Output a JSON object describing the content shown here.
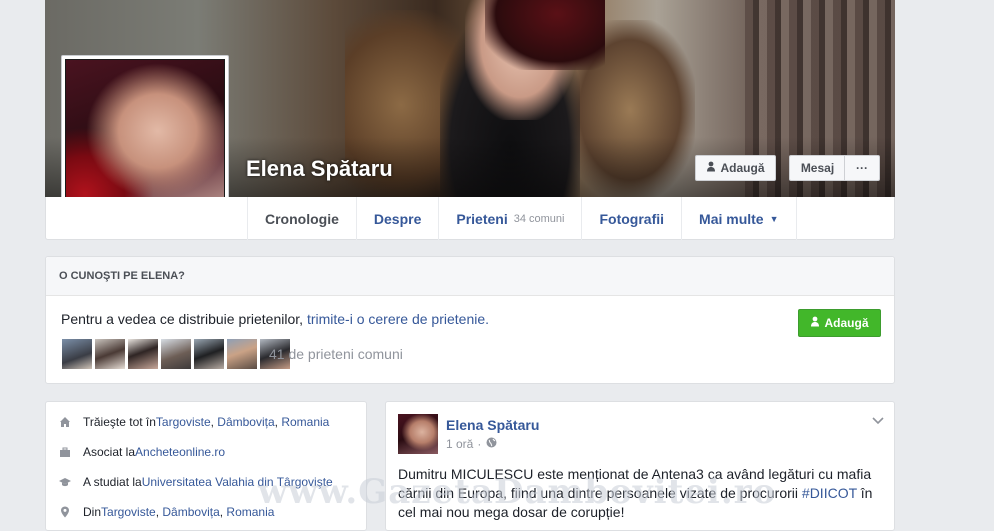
{
  "profile": {
    "name": "Elena Spătaru",
    "buttons": {
      "add_friend": "Adaugă",
      "message": "Mesaj",
      "more": "···"
    }
  },
  "tabs": [
    {
      "label": "Cronologie",
      "active": true
    },
    {
      "label": "Despre"
    },
    {
      "label": "Prieteni",
      "sub": "34 comuni"
    },
    {
      "label": "Fotografii"
    },
    {
      "label": "Mai multe",
      "caret": "▼"
    }
  ],
  "know_card": {
    "heading": "O CUNOŞTI PE ELENA?",
    "text_before": "Pentru a vedea ce distribuie prietenilor, ",
    "text_link": "trimite-i o cerere de prietenie.",
    "add_button": "Adaugă",
    "mutual_friends": "41 de prieteni comuni"
  },
  "intro": [
    {
      "icon": "home-icon",
      "prefix": "Trăieşte tot în ",
      "links": [
        "Targoviste",
        "Dâmbovița",
        "Romania"
      ]
    },
    {
      "icon": "briefcase-icon",
      "prefix": "Asociat la ",
      "links": [
        "Ancheteonline.ro"
      ]
    },
    {
      "icon": "graduation-cap-icon",
      "prefix": "A studiat la ",
      "links": [
        "Universitatea Valahia din Târgovişte"
      ]
    },
    {
      "icon": "location-pin-icon",
      "prefix": "Din ",
      "links": [
        "Targoviste",
        "Dâmbovița",
        "Romania"
      ]
    }
  ],
  "post": {
    "author": "Elena Spătaru",
    "time": "1 oră",
    "separator": "·",
    "text_part1": "Dumitru MICULESCU este menționat de Antena3 ca având legături cu mafia cărnii din Europa, fiind una dintre persoanele vizate de procurorii ",
    "hashtag": "#DIICOT",
    "text_part2": " în cel mai nou mega dosar de corupție!"
  },
  "watermark": "www.GazetaDambovitei.ro",
  "colors": {
    "link": "#365899",
    "green_button": "#42b72a",
    "background": "#e9ebee"
  }
}
